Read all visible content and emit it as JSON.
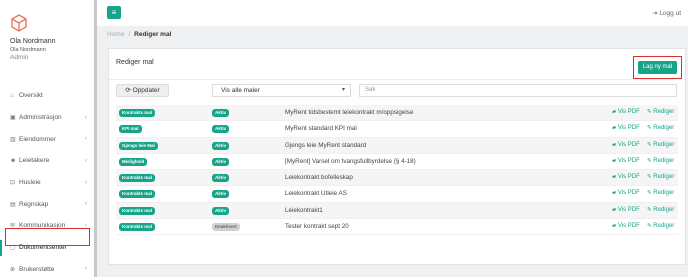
{
  "sidebar": {
    "user": {
      "name": "Ola Nordmann",
      "sub": "Ola Nordmann",
      "role": "Admin"
    },
    "items": [
      {
        "label": "Oversikt",
        "icon": "home-icon",
        "glyph": "⌂",
        "chevron": false
      },
      {
        "label": "Administrasjon",
        "icon": "briefcase-icon",
        "glyph": "▣",
        "chevron": true
      },
      {
        "label": "Eiendommer",
        "icon": "building-icon",
        "glyph": "▥",
        "chevron": true
      },
      {
        "label": "Leietakere",
        "icon": "users-icon",
        "glyph": "☻",
        "chevron": true
      },
      {
        "label": "Husleie",
        "icon": "money-icon",
        "glyph": "⊡",
        "chevron": true
      },
      {
        "label": "Regnskap",
        "icon": "calculator-icon",
        "glyph": "▤",
        "chevron": true
      },
      {
        "label": "Kommunikasjon",
        "icon": "chat-icon",
        "glyph": "✉",
        "chevron": true
      },
      {
        "label": "Dokumentsenter",
        "icon": "document-icon",
        "glyph": "▢",
        "chevron": false
      },
      {
        "label": "Brukerstøtte",
        "icon": "support-icon",
        "glyph": "⊕",
        "chevron": true
      }
    ]
  },
  "topbar": {
    "menu_glyph": "≡",
    "logout_glyph": "⇥",
    "logout_label": "Logg ut"
  },
  "breadcrumb": {
    "home": "Home",
    "separator": "/",
    "current": "Rediger mal"
  },
  "panel": {
    "title": "Rediger mal",
    "new_button": "Lag ny mal",
    "update_button": "⟳ Oppdater",
    "filter_value": "Vis alle maler",
    "search_placeholder": "Søk"
  },
  "templates": [
    {
      "type": "Kontrakts mal",
      "status": "Aktiv",
      "name": "MyRent tidsbestemt leiekontrakt m/oppsigelse"
    },
    {
      "type": "KPI mal",
      "status": "Aktiv",
      "name": "MyRent standard KPI mal"
    },
    {
      "type": "Gjengs leie Mal",
      "status": "Aktiv",
      "name": "Gjengs leie MyRent standard"
    },
    {
      "type": "Mislighold",
      "status": "Aktiv",
      "name": "[MyRent] Varsel om tvangsfullbyrdelse (§ 4-18)"
    },
    {
      "type": "Kontrakts mal",
      "status": "Aktiv",
      "name": "Leiekontrakt bofelleskap"
    },
    {
      "type": "Kontrakts mal",
      "status": "Aktiv",
      "name": "Leiekontrakt Utleie AS"
    },
    {
      "type": "Kontrakts mal",
      "status": "Aktiv",
      "name": "Leiekontrakt1"
    },
    {
      "type": "Kontrakts mal",
      "status": "Deaktivert",
      "name": "Tester kontrakt sept 20"
    }
  ],
  "actions": {
    "pdf_label": "Vis PDF",
    "edit_label": "Rediger",
    "pdf_glyph": "▰",
    "edit_glyph": "✎"
  },
  "colors": {
    "accent": "#17a589",
    "highlight": "#d9302f",
    "inactive_badge": "#d0d0d0"
  }
}
